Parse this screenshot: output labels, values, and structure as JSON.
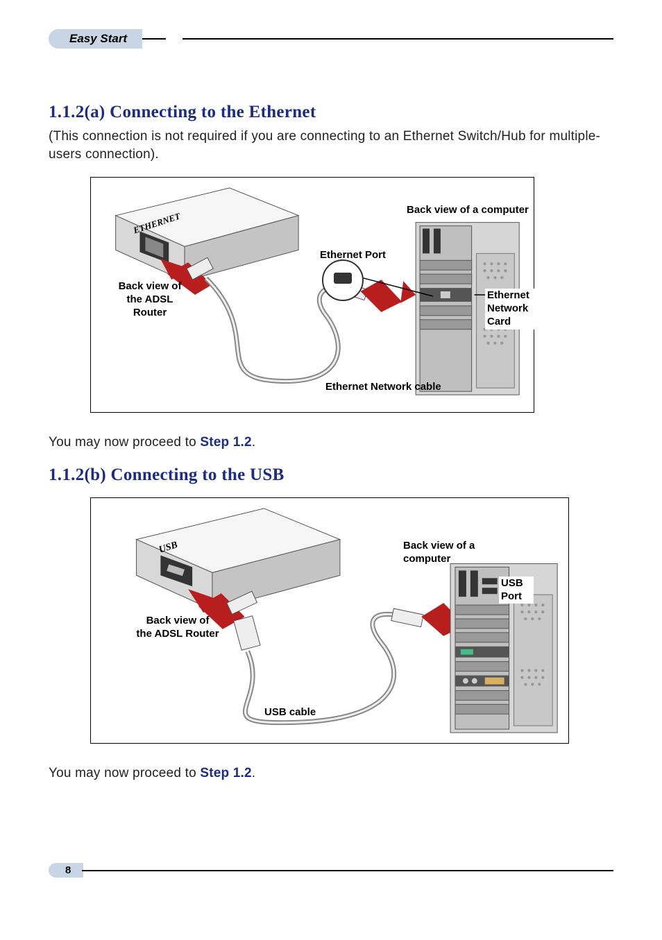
{
  "header": {
    "tab_label": "Easy Start"
  },
  "section_a": {
    "title": "1.1.2(a) Connecting to the Ethernet",
    "intro": "(This connection is not required if you are connecting to an Ethernet Switch/Hub for multiple-users connection).",
    "labels": {
      "router_back": "Back view of\nthe ADSL\nRouter",
      "router_port_label": "ETHERNET",
      "ethernet_port": "Ethernet Port",
      "computer_back": "Back view of a computer",
      "ethernet_card": "Ethernet\nNetwork Card",
      "cable": "Ethernet Network cable"
    },
    "proceed_prefix": "You may now proceed to ",
    "proceed_step": "Step 1.2",
    "proceed_suffix": "."
  },
  "section_b": {
    "title": "1.1.2(b) Connecting to the USB",
    "labels": {
      "router_back": "Back view of\nthe ADSL Router",
      "router_port_label": "USB",
      "computer_back": "Back view of a\ncomputer",
      "usb_port": "USB\nPort",
      "cable": "USB cable"
    },
    "proceed_prefix": "You may now proceed to ",
    "proceed_step": "Step 1.2",
    "proceed_suffix": "."
  },
  "footer": {
    "page_number": "8"
  }
}
